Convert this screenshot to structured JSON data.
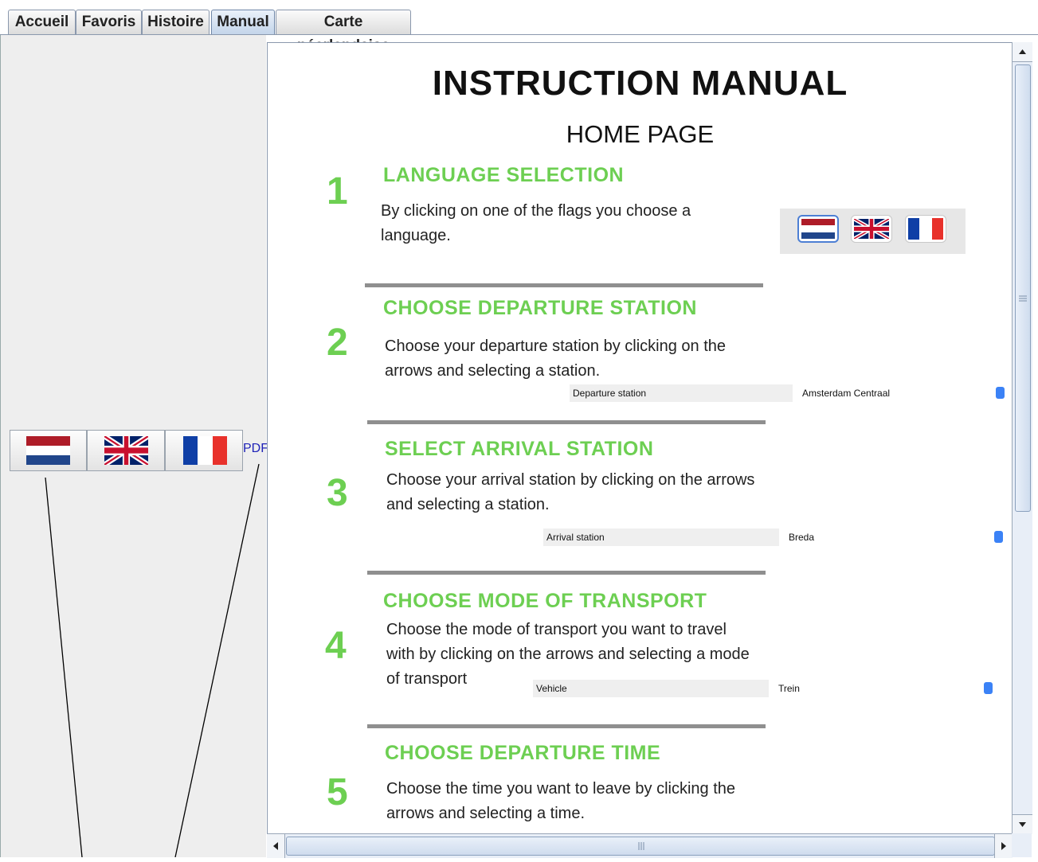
{
  "tabs": [
    {
      "label": "Accueil"
    },
    {
      "label": "Favoris"
    },
    {
      "label": "Histoire"
    },
    {
      "label": "Manual"
    },
    {
      "label": "Carte néerlandaise"
    }
  ],
  "active_tab": "Manual",
  "left_panel": {
    "flags": [
      "netherlands-flag-icon",
      "uk-flag-icon",
      "france-flag-icon"
    ],
    "pdf_label": "PDF"
  },
  "manual": {
    "title": "INSTRUCTION MANUAL",
    "subtitle": "HOME PAGE",
    "sections": [
      {
        "number": "1",
        "heading": "LANGUAGE SELECTION",
        "lines": [
          "By clicking on one of the flags you choose a",
          "language."
        ]
      },
      {
        "number": "2",
        "heading": "CHOOSE DEPARTURE STATION",
        "lines": [
          "Choose your departure station by clicking on the",
          "arrows and selecting a station."
        ],
        "field_label": "Departure station",
        "field_value": "Amsterdam Centraal"
      },
      {
        "number": "3",
        "heading": "SELECT ARRIVAL STATION",
        "lines": [
          "Choose your arrival station by clicking on the arrows",
          "and selecting a station."
        ],
        "field_label": "Arrival station",
        "field_value": "Breda"
      },
      {
        "number": "4",
        "heading": "CHOOSE MODE OF TRANSPORT",
        "lines": [
          "Choose the mode of transport you want to travel",
          "with by clicking on the arrows and selecting a mode",
          "of transport"
        ],
        "field_label": "Vehicle",
        "field_value": "Trein"
      },
      {
        "number": "5",
        "heading": "CHOOSE DEPARTURE TIME",
        "lines": [
          "Choose the time you want to leave by clicking the",
          "arrows and selecting a time."
        ]
      }
    ]
  },
  "colors": {
    "accent_green": "#6dcf52",
    "pdf_link": "#1f23b8",
    "active_tab": "#c4d5ea"
  }
}
